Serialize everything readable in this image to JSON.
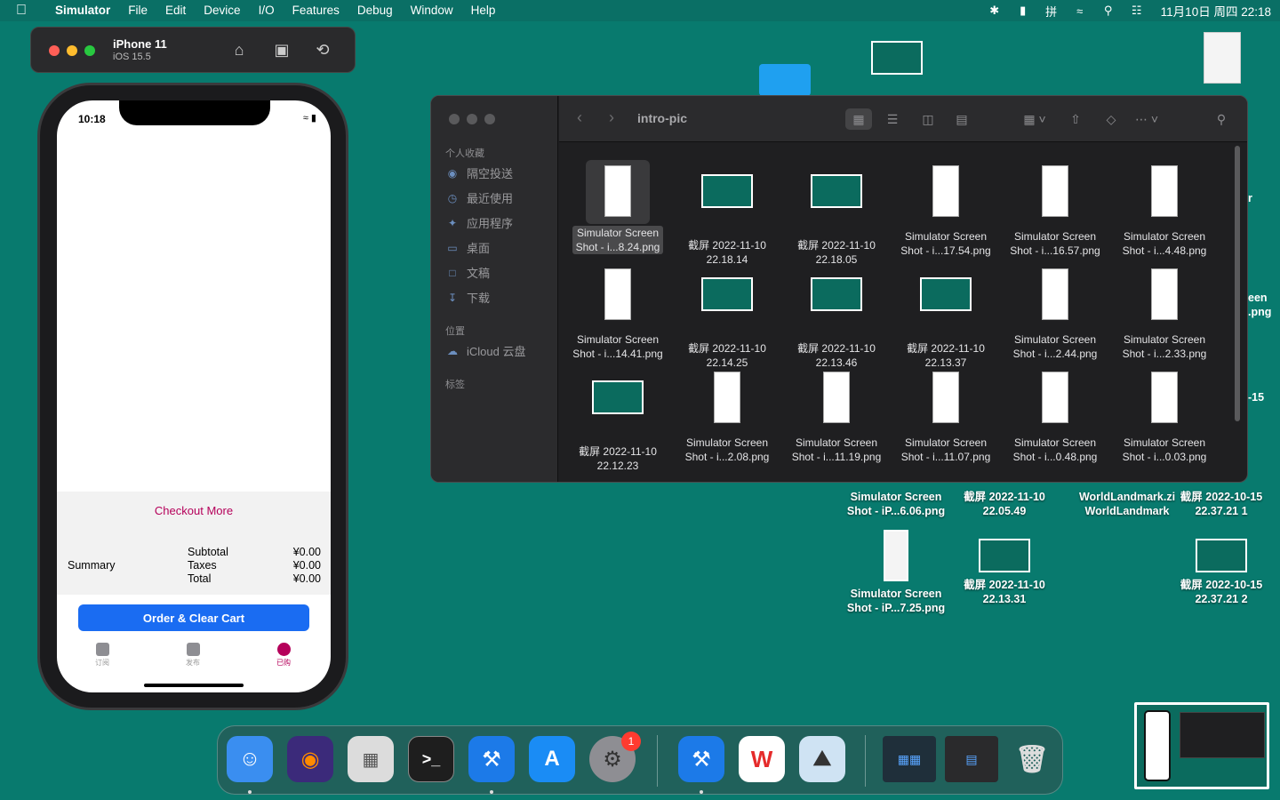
{
  "menubar": {
    "app": "Simulator",
    "items": [
      "File",
      "Edit",
      "Device",
      "I/O",
      "Features",
      "Debug",
      "Window",
      "Help"
    ],
    "clock": "11月10日 周四  22:18"
  },
  "simulator": {
    "device_name": "iPhone 11",
    "os_version": "iOS 15.5"
  },
  "phone": {
    "status_time": "10:18",
    "checkout_more": "Checkout More",
    "summary_label": "Summary",
    "subtotal_label": "Subtotal",
    "subtotal_value": "¥0.00",
    "taxes_label": "Taxes",
    "taxes_value": "¥0.00",
    "total_label": "Total",
    "total_value": "¥0.00",
    "order_button": "Order & Clear Cart",
    "tabs": [
      {
        "label": "订阅",
        "icon": "bookmark-icon"
      },
      {
        "label": "发布",
        "icon": "book-icon"
      },
      {
        "label": "已购",
        "icon": "cart-icon"
      }
    ],
    "accent": "#b5005a",
    "button_color": "#1a6cf2"
  },
  "finder": {
    "title": "intro-pic",
    "sidebar": {
      "favorites_header": "个人收藏",
      "favorites": [
        "隔空投送",
        "最近使用",
        "应用程序",
        "桌面",
        "文稿",
        "下载"
      ],
      "locations_header": "位置",
      "locations": [
        "iCloud 云盘"
      ],
      "tags_header": "标签"
    },
    "files": [
      {
        "line1": "Simulator Screen",
        "line2": "Shot - i...8.24.png",
        "kind": "tall",
        "selected": true
      },
      {
        "line1": "截屏 2022-11-10",
        "line2": "22.18.14",
        "kind": "wide"
      },
      {
        "line1": "截屏 2022-11-10",
        "line2": "22.18.05",
        "kind": "wide"
      },
      {
        "line1": "Simulator Screen",
        "line2": "Shot - i...17.54.png",
        "kind": "tall"
      },
      {
        "line1": "Simulator Screen",
        "line2": "Shot - i...16.57.png",
        "kind": "tall"
      },
      {
        "line1": "Simulator Screen",
        "line2": "Shot - i...4.48.png",
        "kind": "tall"
      },
      {
        "line1": "Simulator Screen",
        "line2": "Shot - i...14.41.png",
        "kind": "tall"
      },
      {
        "line1": "截屏 2022-11-10",
        "line2": "22.14.25",
        "kind": "wide"
      },
      {
        "line1": "截屏 2022-11-10",
        "line2": "22.13.46",
        "kind": "wide"
      },
      {
        "line1": "截屏 2022-11-10",
        "line2": "22.13.37",
        "kind": "wide"
      },
      {
        "line1": "Simulator Screen",
        "line2": "Shot - i...2.44.png",
        "kind": "tall"
      },
      {
        "line1": "Simulator Screen",
        "line2": "Shot - i...2.33.png",
        "kind": "tall"
      },
      {
        "line1": "截屏 2022-11-10",
        "line2": "22.12.23",
        "kind": "wide"
      },
      {
        "line1": "Simulator Screen",
        "line2": "Shot - i...2.08.png",
        "kind": "tall"
      },
      {
        "line1": "Simulator Screen",
        "line2": "Shot - i...11.19.png",
        "kind": "tall"
      },
      {
        "line1": "Simulator Screen",
        "line2": "Shot - i...11.07.png",
        "kind": "tall"
      },
      {
        "line1": "Simulator Screen",
        "line2": "Shot - i...0.48.png",
        "kind": "tall"
      },
      {
        "line1": "Simulator Screen",
        "line2": "Shot - i...0.03.png",
        "kind": "tall"
      }
    ]
  },
  "desktop": {
    "icons": [
      {
        "line1": "Simulator Screen",
        "line2": "Shot - iP...6.06.png"
      },
      {
        "line1": "截屏 2022-11-10",
        "line2": "22.05.49"
      },
      {
        "line1": "WorldLandmark.zi",
        "line2": "WorldLandmark"
      },
      {
        "line1": "截屏 2022-10-15",
        "line2": "22.37.21 1"
      },
      {
        "line1": "Simulator Screen",
        "line2": "Shot - iP...7.25.png"
      },
      {
        "line1": "截屏 2022-11-10",
        "line2": "22.13.31"
      },
      {
        "line1": "截屏 2022-10-15",
        "line2": "22.37.21 2"
      }
    ],
    "partial_labels": [
      "r",
      "een",
      ".png",
      "-15"
    ]
  },
  "dock": {
    "apps": [
      "finder-icon",
      "firefox-icon",
      "launchpad-icon",
      "terminal-icon",
      "xcode-icon",
      "app-store-icon",
      "system-preferences-icon",
      "simulator-icon",
      "wps-icon",
      "preview-icon",
      "downloads-stack-icon",
      "screenshots-stack-icon",
      "trash-icon"
    ],
    "badge": "1"
  }
}
